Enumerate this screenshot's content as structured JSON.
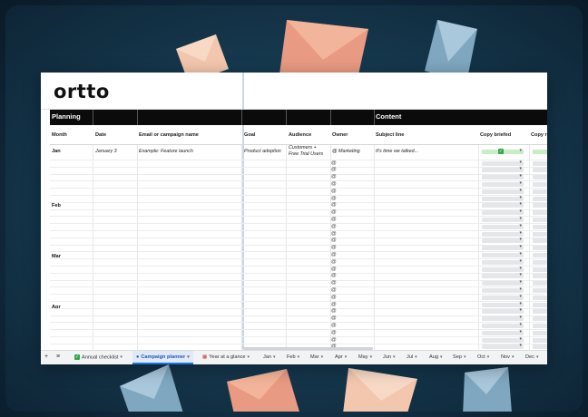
{
  "logo": "ortto",
  "sections": {
    "planning": "Planning",
    "content": "Content"
  },
  "headers": {
    "month": "Month",
    "date": "Date",
    "email_name": "Email or campaign name",
    "goal": "Goal",
    "audience": "Audience",
    "owner": "Owner",
    "subject": "Subject line",
    "copy_briefed": "Copy briefed",
    "copy_next": "Copy r"
  },
  "first_row": {
    "month": "Jan",
    "date": "January 3",
    "email_name": "Example: Feature launch",
    "goal": "Product adoption",
    "audience_line1": "Customers +",
    "audience_line2": "Free Trial Users",
    "owner": "@ Marketing",
    "subject": "It's time we talked..."
  },
  "months": {
    "feb": "Feb",
    "mar": "Mar",
    "apr": "Apr"
  },
  "owner_glyph": "@",
  "check_glyph": "✓",
  "tabs": {
    "add": "+",
    "menu": "≡",
    "annual": "Annual checklist",
    "planner": "Campaign planner",
    "glance": "Year at a glance",
    "jan": "Jan",
    "feb": "Feb",
    "mar": "Mar",
    "apr": "Apr",
    "may": "May",
    "jun": "Jun",
    "jul": "Jul",
    "aug": "Aug",
    "sep": "Sep",
    "oct": "Oct",
    "nov": "Nov",
    "dec": "Dec"
  },
  "colors": {
    "accent": "#1a73e8",
    "check_green": "#2fa84f",
    "envelope_peach": "#f2b49a",
    "envelope_blue": "#8fb7cf"
  }
}
